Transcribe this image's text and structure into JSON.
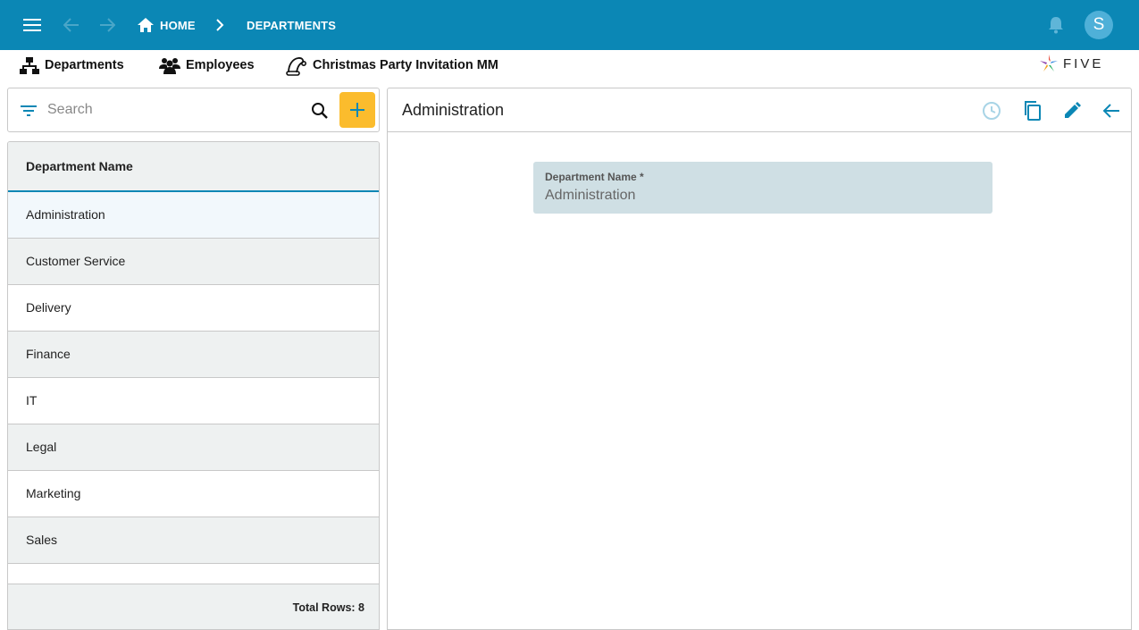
{
  "appbar": {
    "breadcrumbs": [
      "HOME",
      "DEPARTMENTS"
    ],
    "avatar_initial": "S",
    "color": "#0b87b5"
  },
  "menu": {
    "items": [
      {
        "label": "Departments",
        "icon": "sitemap-icon"
      },
      {
        "label": "Employees",
        "icon": "users-icon"
      },
      {
        "label": "Christmas Party Invitation MM",
        "icon": "santa-hat-icon"
      }
    ],
    "logo_text": "FIVE"
  },
  "search": {
    "placeholder": "Search",
    "add_button_color": "#fbbc2d"
  },
  "list": {
    "header": "Department Name",
    "rows": [
      "Administration",
      "Customer Service",
      "Delivery",
      "Finance",
      "IT",
      "Legal",
      "Marketing",
      "Sales"
    ],
    "selected_index": 0,
    "total_rows_label": "Total Rows: 8"
  },
  "detail": {
    "title": "Administration",
    "field_label": "Department Name *",
    "field_value": "Administration",
    "tools": [
      "history-icon",
      "copy-icon",
      "edit-icon",
      "back-arrow-icon"
    ]
  }
}
